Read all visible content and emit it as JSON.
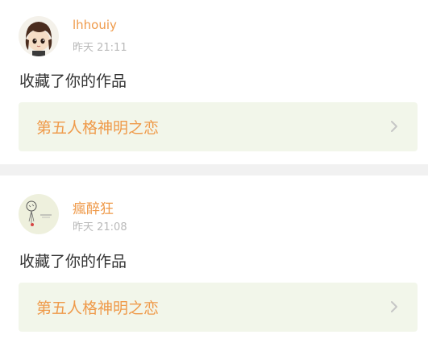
{
  "notifications": [
    {
      "user": "lhhouiy",
      "time": "昨天 21:11",
      "action": "收藏了你的作品",
      "work_title": "第五人格神明之恋",
      "avatar_icon": "chibi-girl-avatar"
    },
    {
      "user": "瘋醉狂",
      "time": "昨天 21:08",
      "action": "收藏了你的作品",
      "work_title": "第五人格神明之恋",
      "avatar_icon": "balloon-sketch-avatar"
    }
  ],
  "colors": {
    "accent": "#ef9a4a",
    "muted": "#b9b9b9",
    "link_bg": "#f2f6ea",
    "page_bg": "#f1f1f1"
  }
}
